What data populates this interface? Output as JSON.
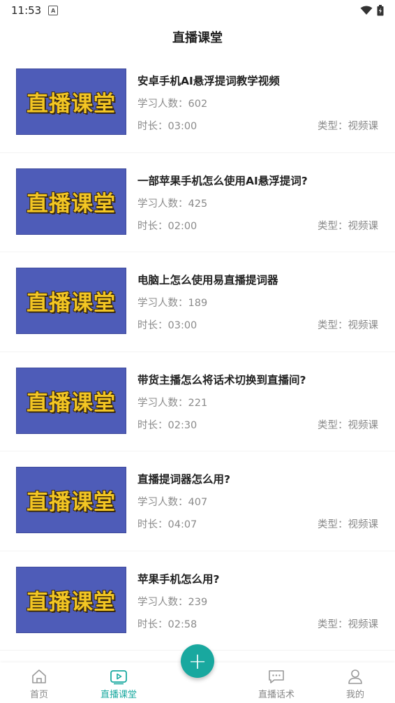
{
  "status": {
    "time": "11:53",
    "notif_letter": "A"
  },
  "header": {
    "title": "直播课堂"
  },
  "courses": [
    {
      "thumb_text": "直播课堂",
      "title": "安卓手机AI悬浮提词教学视频",
      "learners": "学习人数：602",
      "duration": "时长：03:00",
      "type": "类型：视频课"
    },
    {
      "thumb_text": "直播课堂",
      "title": "一部苹果手机怎么使用AI悬浮提词?",
      "learners": "学习人数：425",
      "duration": "时长：02:00",
      "type": "类型：视频课"
    },
    {
      "thumb_text": "直播课堂",
      "title": "电脑上怎么使用易直播提词器",
      "learners": "学习人数：189",
      "duration": "时长：03:00",
      "type": "类型：视频课"
    },
    {
      "thumb_text": "直播课堂",
      "title": "带货主播怎么将话术切换到直播间?",
      "learners": "学习人数：221",
      "duration": "时长：02:30",
      "type": "类型：视频课"
    },
    {
      "thumb_text": "直播课堂",
      "title": "直播提词器怎么用?",
      "learners": "学习人数：407",
      "duration": "时长：04:07",
      "type": "类型：视频课"
    },
    {
      "thumb_text": "直播课堂",
      "title": "苹果手机怎么用?",
      "learners": "学习人数：239",
      "duration": "时长：02:58",
      "type": "类型：视频课"
    }
  ],
  "tabs": [
    {
      "label": "首页",
      "icon": "home-icon"
    },
    {
      "label": "直播课堂",
      "icon": "video-play-icon"
    },
    {
      "label": "直播话术",
      "icon": "chat-icon"
    },
    {
      "label": "我的",
      "icon": "user-icon"
    }
  ],
  "fab": {
    "symbol": "+"
  },
  "colors": {
    "accent": "#1aa9a0",
    "thumb_bg": "#4e5cb8",
    "thumb_text": "#f3c623"
  }
}
